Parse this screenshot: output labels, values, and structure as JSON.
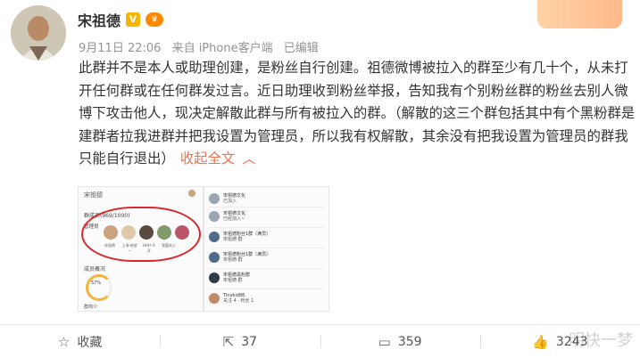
{
  "post": {
    "author": "宋祖德",
    "verified_badge": "V",
    "date": "9月11日 22:06",
    "source": "来自 iPhone客户端",
    "edited": "已编辑",
    "body": "此群并不是本人或助理创建，是粉丝自行创建。祖德微博被拉入的群至少有几十个，从未打开任何群或在任何群发过言。近日助理收到粉丝举报，告知我有个别粉丝群的粉丝去别人微博下攻击他人，现决定解散此群与所有被拉入的群。（解散的这三个群包括其中有个黑粉群是建群者拉我进群并把我设置为管理员，所以我有权解散，其余没有把我设置为管理员的群我只能自行退出）",
    "collapse_label": "收起全文",
    "collapse_icon": "chevron-up-icon"
  },
  "screenshot1": {
    "title": "宋祖德",
    "members_label": "群成员(969/1000)",
    "admin_label": "管理员",
    "member_names": [
      "宋祖德",
      "上海·哈喽~",
      "HHH·不开",
      "我喜欢人"
    ],
    "stats_label": "成员概况",
    "ratio": "57%",
    "ratio_caption": "活跃成员",
    "ratio_sub": "女",
    "footer": "群简介"
  },
  "screenshot2": {
    "rows": [
      {
        "title": "宋祖德文化",
        "sub": "已加入"
      },
      {
        "title": "宋祖德文化",
        "sub": "已经加入~"
      },
      {
        "title": "宋祖德粉丝1群（满员）",
        "sub": "宋祖德·群"
      },
      {
        "title": "宋祖德粉丝1群（满员）",
        "sub": "宋祖德·群"
      },
      {
        "title": "宋祖德黑粉群",
        "sub": "宋祖德·群"
      },
      {
        "title": "Tinykid88",
        "sub": "关注 4 · 粉丝 1"
      }
    ]
  },
  "actions": {
    "favorite": "收藏",
    "repost": "37",
    "comment": "359",
    "like": "3243"
  },
  "watermark": "明快一梦",
  "colors": {
    "link": "#eb7350",
    "annotation_ring": "#d9272e"
  }
}
